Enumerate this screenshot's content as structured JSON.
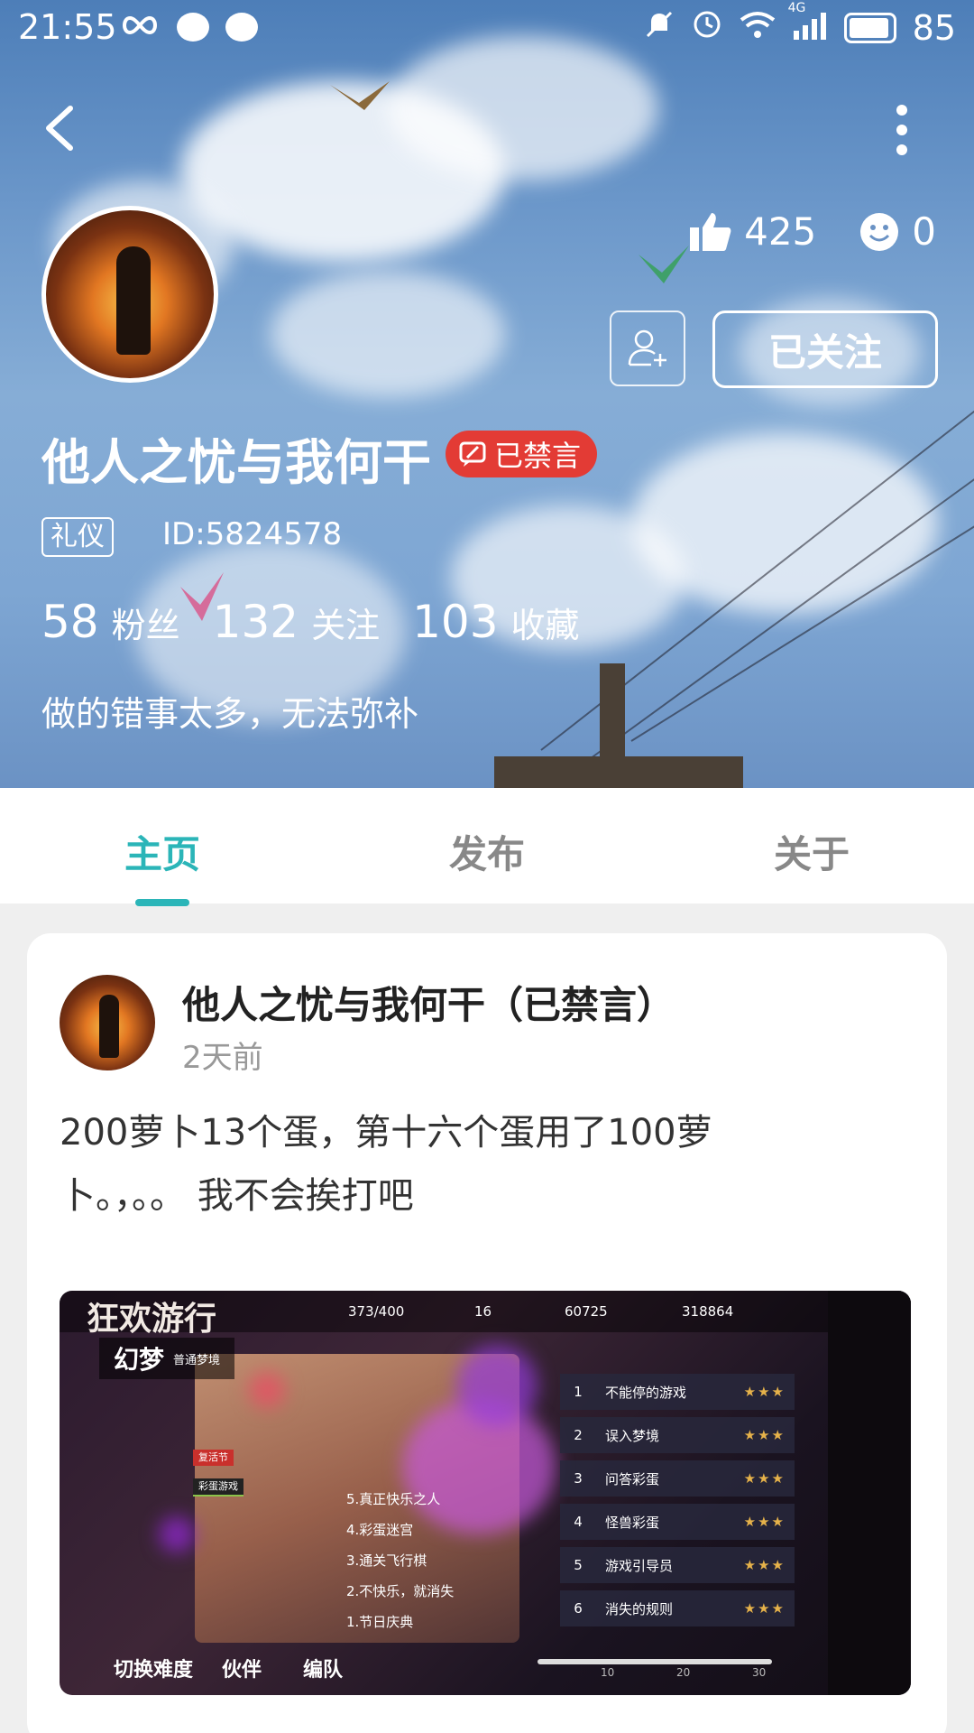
{
  "status_bar": {
    "time": "21:55",
    "battery": "85",
    "network": "4G"
  },
  "profile": {
    "likes": "425",
    "smiles": "0",
    "follow_label": "已关注",
    "username": "他人之忧与我何干",
    "banned_label": "已禁言",
    "title_tag": "礼仪",
    "user_id": "ID:5824578",
    "fans_count": "58",
    "fans_label": "粉丝",
    "following_count": "132",
    "following_label": "关注",
    "favorites_count": "103",
    "favorites_label": "收藏",
    "bio": "做的错事太多，无法弥补"
  },
  "tabs": [
    {
      "label": "主页",
      "active": true
    },
    {
      "label": "发布",
      "active": false
    },
    {
      "label": "关于",
      "active": false
    }
  ],
  "post": {
    "author": "他人之忧与我何干（已禁言）",
    "time": "2天前",
    "text_line1": "200萝卜13个蛋，第十六个蛋用了100萝",
    "text_line2": "卜。，。。 我不会挨打吧"
  },
  "game_screenshot": {
    "title": "狂欢游行",
    "mode": "幻梦",
    "mode_sub": "普通梦境",
    "carrots": "373/400",
    "eggs": "16",
    "crystals": "60725",
    "coins": "318864",
    "tag1": "复活节",
    "tag2": "彩蛋游戏",
    "sub_levels": [
      "5.真正快乐之人",
      "4.彩蛋迷宫",
      "3.通关飞行棋",
      "2.不快乐，就消失",
      "1.节日庆典"
    ],
    "levels": [
      {
        "n": "1",
        "name": "不能停的游戏",
        "stars": "★★★"
      },
      {
        "n": "2",
        "name": "误入梦境",
        "stars": "★★★"
      },
      {
        "n": "3",
        "name": "问答彩蛋",
        "stars": "★★★"
      },
      {
        "n": "4",
        "name": "怪兽彩蛋",
        "stars": "★★★"
      },
      {
        "n": "5",
        "name": "游戏引导员",
        "stars": "★★★"
      },
      {
        "n": "6",
        "name": "消失的规则",
        "stars": "★★★"
      }
    ],
    "progress_marks": [
      "10",
      "20",
      "30"
    ],
    "bottom_buttons": [
      "切换难度",
      "伙伴",
      "编队"
    ]
  },
  "colors": {
    "accent": "#2bb5b8",
    "banned": "#e33b35"
  }
}
